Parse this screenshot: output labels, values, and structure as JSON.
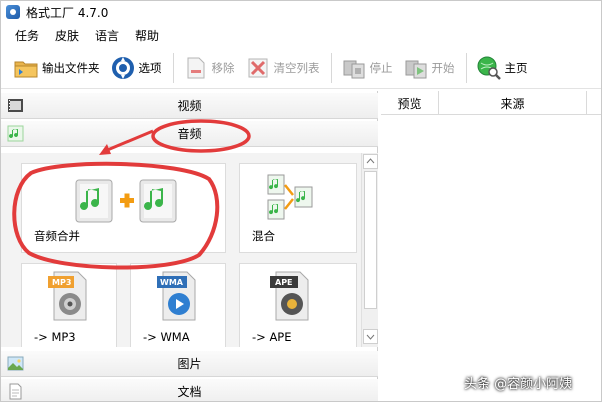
{
  "window": {
    "title": "格式工厂 4.7.0"
  },
  "menu": [
    "任务",
    "皮肤",
    "语言",
    "帮助"
  ],
  "toolbar": {
    "output_folder": "输出文件夹",
    "options": "选项",
    "remove": "移除",
    "clear_list": "清空列表",
    "stop": "停止",
    "start": "开始",
    "home": "主页"
  },
  "categories": {
    "video": "视频",
    "audio": "音频",
    "image": "图片",
    "document": "文档"
  },
  "tiles": {
    "audio_merge": "音频合并",
    "mix": "混合",
    "mp3": "-> MP3",
    "wma": "-> WMA",
    "ape": "-> APE",
    "mp3_badge": "MP3",
    "wma_badge": "WMA",
    "ape_badge": "APE"
  },
  "right_panel": {
    "columns": [
      "预览",
      "来源"
    ]
  },
  "watermark": "头条 @容颜小阿姨",
  "colors": {
    "annotation_red": "#e23b3b",
    "icon_green": "#3bb54a",
    "plus_orange": "#f39c12"
  }
}
